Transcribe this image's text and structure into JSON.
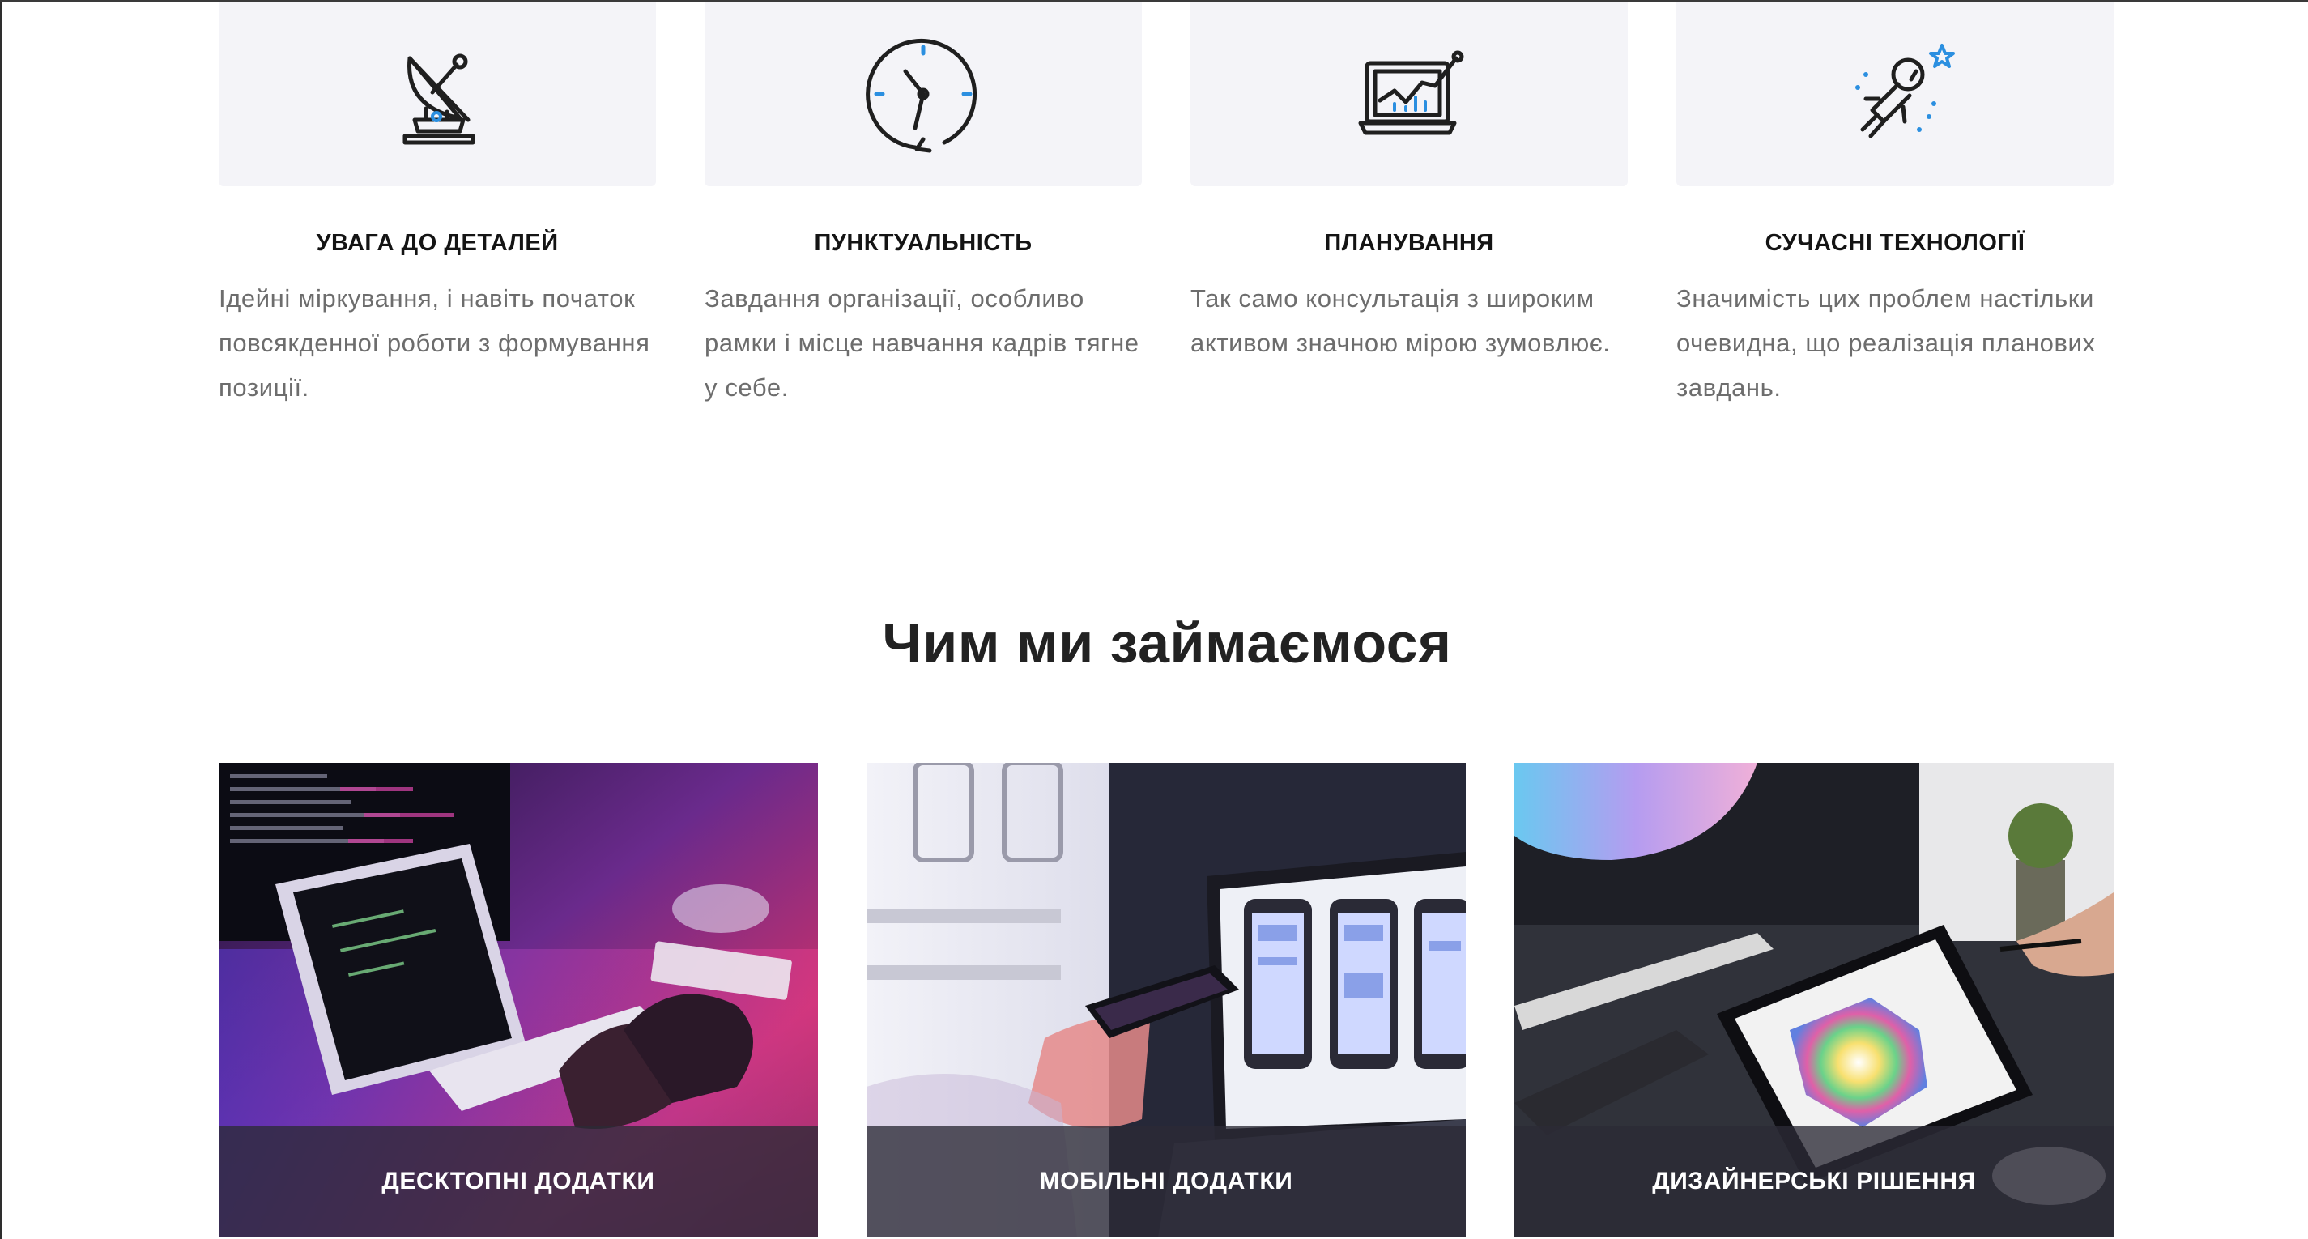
{
  "features": [
    {
      "icon": "satellite-dish-icon",
      "title": "УВАГА ДО ДЕТАЛЕЙ",
      "text": "Ідейні міркування, і навіть початок повсякденної роботи з формування позиції."
    },
    {
      "icon": "clock-icon",
      "title": "ПУНКТУАЛЬНІСТЬ",
      "text": "Завдання організації, особливо рамки і місце навчання кадрів тягне у себе."
    },
    {
      "icon": "laptop-chart-icon",
      "title": "ПЛАНУВАННЯ",
      "text": "Так само консультація з широким активом значною мірою зумовлює."
    },
    {
      "icon": "astronaut-icon",
      "title": "СУЧАСНІ ТЕХНОЛОГІЇ",
      "text": "Значимість цих проблем настільки очевидна, що реалізація планових завдань."
    }
  ],
  "section": {
    "title": "Чим ми займаємося"
  },
  "services": [
    {
      "label": "ДЕСКТОПНІ ДОДАТКИ",
      "image": "desktop-apps-photo"
    },
    {
      "label": "МОБІЛЬНІ ДОДАТКИ",
      "image": "mobile-apps-photo"
    },
    {
      "label": "ДИЗАЙНЕРСЬКІ РІШЕННЯ",
      "image": "design-solutions-photo"
    }
  ],
  "colors": {
    "accent": "#2b8fe0",
    "icon_stroke": "#1f1f1f",
    "card_background": "#f4f4f8",
    "caption_overlay": "#2c2a36"
  }
}
